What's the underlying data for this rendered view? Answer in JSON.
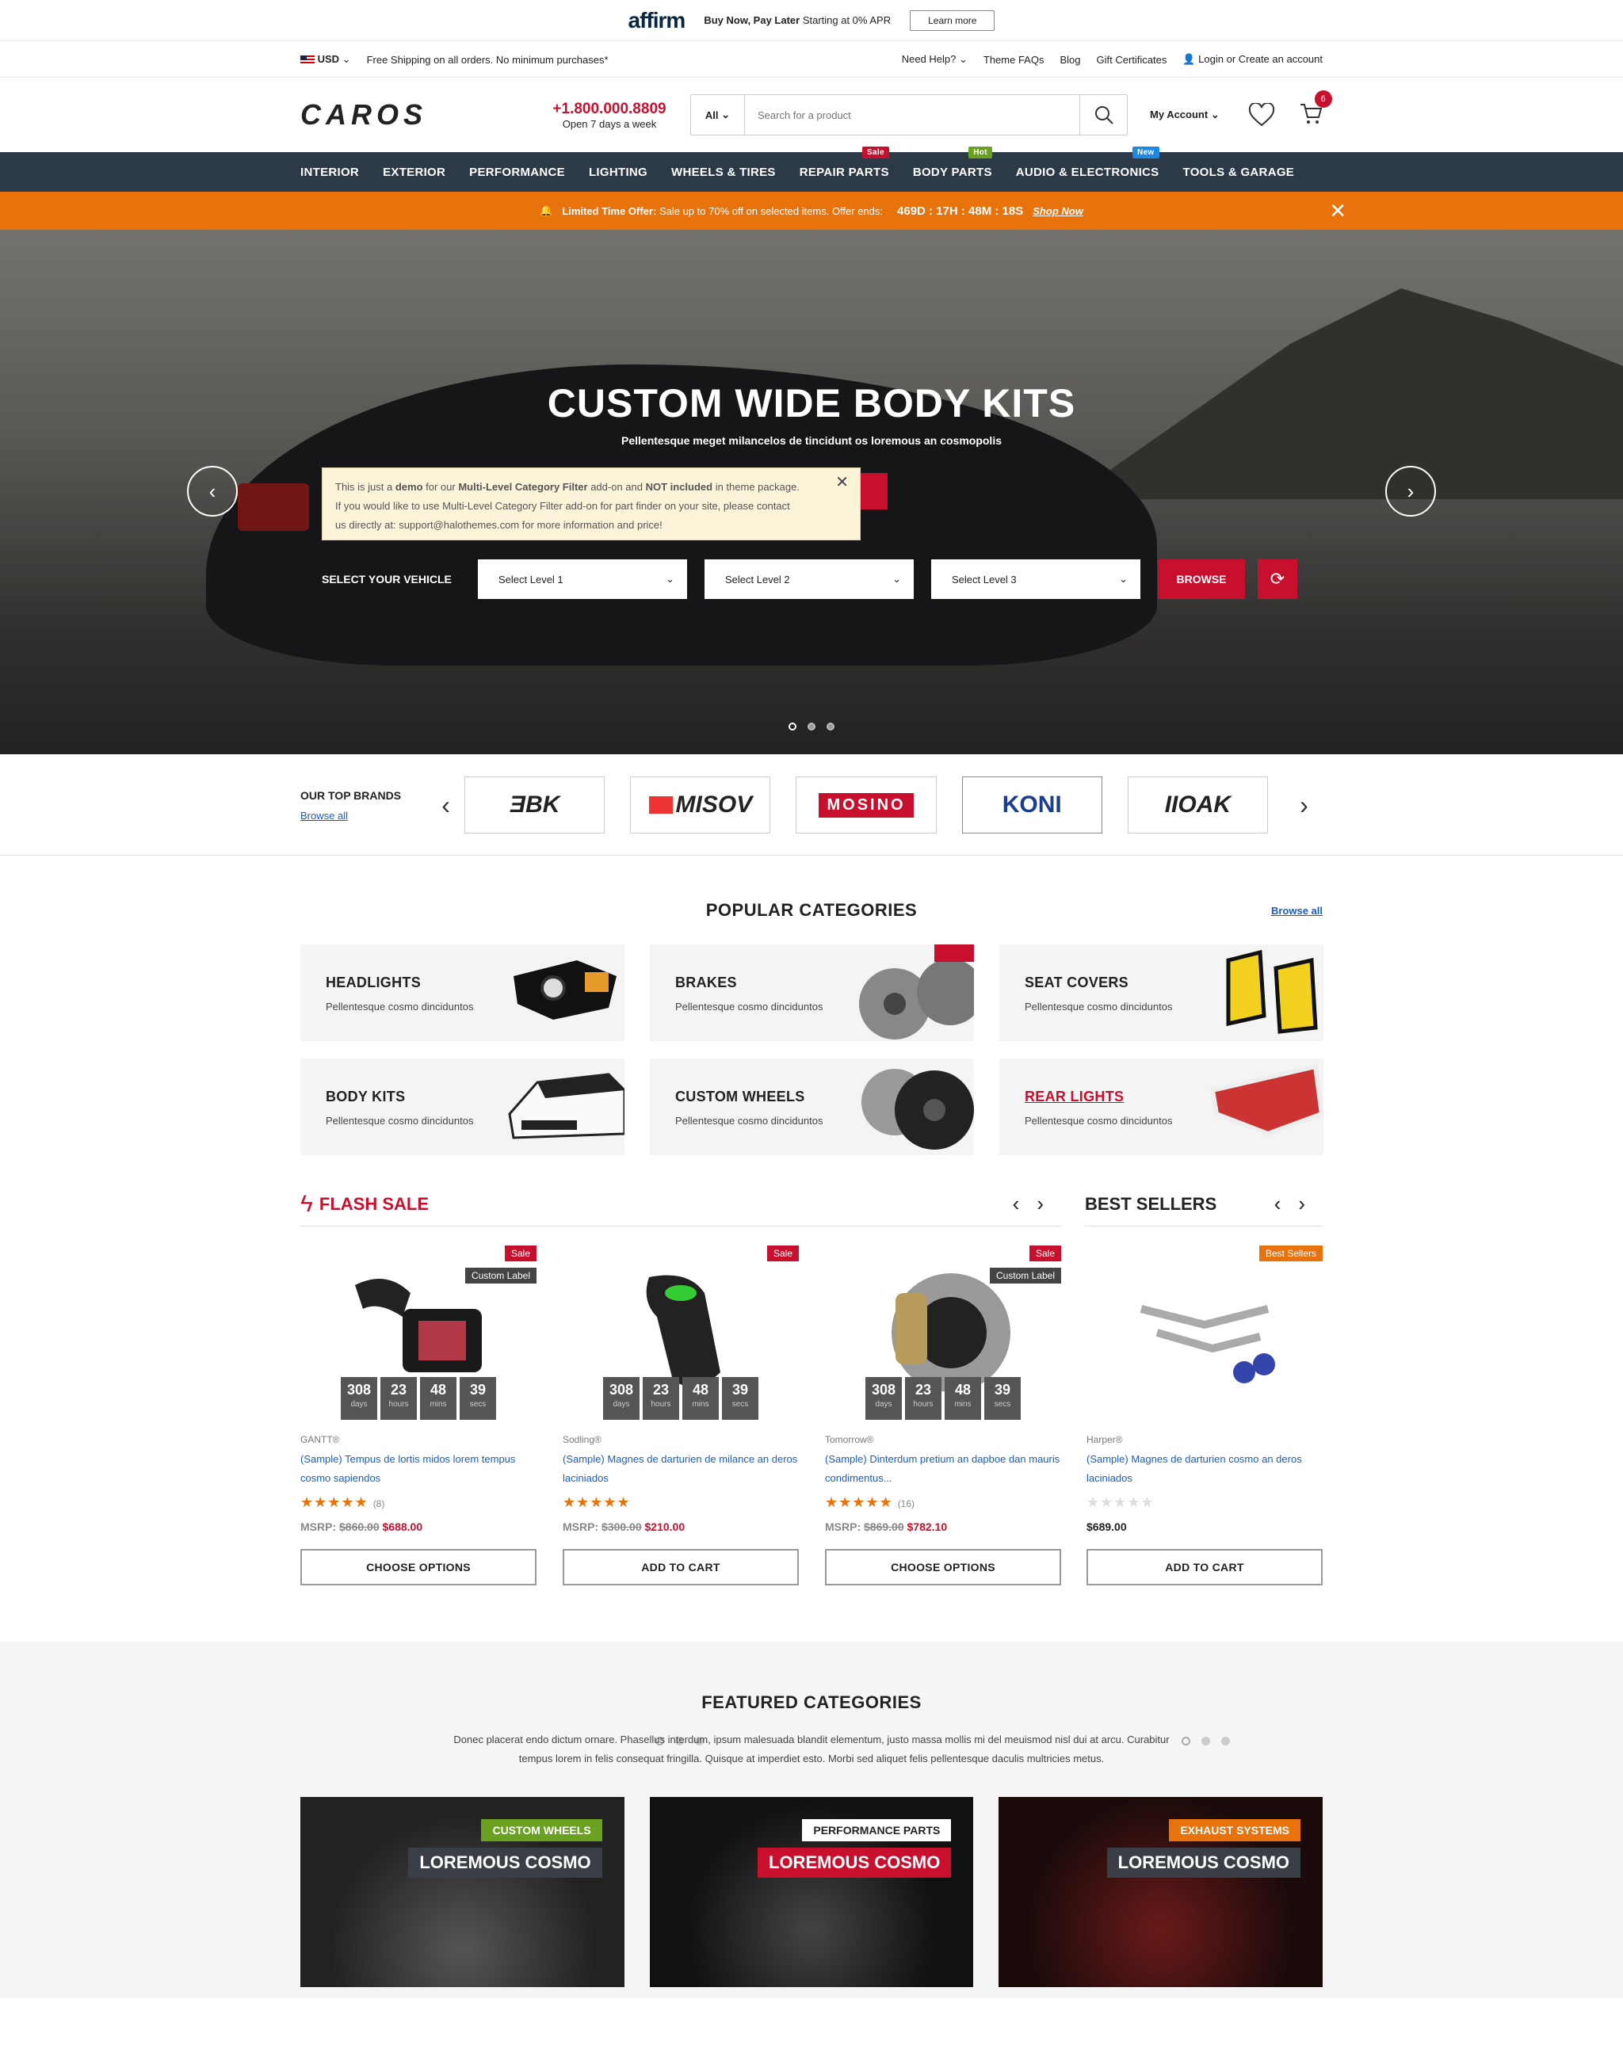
{
  "affirm": {
    "logo": "affirm",
    "text_bold": "Buy Now, Pay Later",
    "text": " Starting at 0% APR",
    "button": "Learn more"
  },
  "topbar": {
    "currency": "USD",
    "shipping": "Free Shipping on all orders. No minimum purchases*",
    "links": [
      "Need Help?",
      "Theme FAQs",
      "Blog",
      "Gift Certificates"
    ],
    "login": "Login or Create an account"
  },
  "header": {
    "logo": "CAROS",
    "phone": "+1.800.000.8809",
    "phone_sub": "Open 7 days a week",
    "search_cat": "All",
    "search_placeholder": "Search for a product",
    "account": "My Account",
    "cart_count": "6"
  },
  "nav": {
    "items": [
      "INTERIOR",
      "EXTERIOR",
      "PERFORMANCE",
      "LIGHTING",
      "WHEELS & TIRES",
      "REPAIR PARTS",
      "BODY PARTS",
      "AUDIO & ELECTRONICS",
      "TOOLS & GARAGE"
    ],
    "tags": {
      "sale": "Sale",
      "hot": "Hot",
      "new": "New"
    },
    "tag_colors": {
      "sale": "#c8102e",
      "hot": "#6aa121",
      "new": "#1e88e5"
    }
  },
  "promo": {
    "label": "Limited Time Offer:",
    "text": "Sale up to 70% off on selected items. Offer ends:",
    "countdown": "469D : 17H : 48M : 18S",
    "link": "Shop Now"
  },
  "hero": {
    "title": "CUSTOM WIDE BODY KITS",
    "subtitle": "Pellentesque meget milancelos de tincidunt os loremous an cosmopolis",
    "notice_1": "This is just a ",
    "notice_demo": "demo",
    "notice_2": " for our ",
    "notice_addon": "Multi-Level Category Filter",
    "notice_3": " add-on and ",
    "notice_not": "NOT included",
    "notice_4": " in theme package.",
    "notice_line2": "If you would like to use Multi-Level Category Filter add-on for part finder on your site, please contact",
    "notice_line3": "us directly at: support@halothemes.com for more information and price!",
    "finder_label": "SELECT YOUR VEHICLE",
    "levels": [
      "Select Level 1",
      "Select Level 2",
      "Select Level 3"
    ],
    "browse": "BROWSE"
  },
  "brands": {
    "title": "OUR TOP BRANDS",
    "browse": "Browse all",
    "logos": [
      "ƎBK",
      "MISOV",
      "MOSINO",
      "KONI",
      "IIOAK"
    ]
  },
  "popular": {
    "title": "POPULAR CATEGORIES",
    "browse": "Browse all",
    "items": [
      {
        "title": "HEADLIGHTS",
        "sub": "Pellentesque cosmo dinciduntos"
      },
      {
        "title": "BRAKES",
        "sub": "Pellentesque cosmo dinciduntos"
      },
      {
        "title": "SEAT COVERS",
        "sub": "Pellentesque cosmo dinciduntos"
      },
      {
        "title": "BODY KITS",
        "sub": "Pellentesque cosmo dinciduntos"
      },
      {
        "title": "CUSTOM WHEELS",
        "sub": "Pellentesque cosmo dinciduntos"
      },
      {
        "title": "REAR LIGHTS",
        "sub": "Pellentesque cosmo dinciduntos"
      }
    ]
  },
  "flash": {
    "title": "FLASH SALE",
    "bestsellers": "BEST SELLERS",
    "timer": {
      "days": "308",
      "hours": "23",
      "mins": "48",
      "secs": "39",
      "l_days": "days",
      "l_hours": "hours",
      "l_mins": "mins",
      "l_secs": "secs"
    },
    "products": [
      {
        "brand": "GANTT®",
        "name": "(Sample) Tempus de lortis midos lorem tempus cosmo sapiendos",
        "reviews": "(8)",
        "msrp": "MSRP:",
        "old": "$860.00",
        "price": "$688.00",
        "button": "CHOOSE OPTIONS",
        "label1": "Sale",
        "label2": "Custom Label"
      },
      {
        "brand": "Sodling®",
        "name": "(Sample) Magnes de darturien de milance an deros laciniados",
        "reviews": "",
        "msrp": "MSRP:",
        "old": "$300.00",
        "price": "$210.00",
        "button": "ADD TO CART",
        "label1": "Sale",
        "label2": ""
      },
      {
        "brand": "Tomorrow®",
        "name": "(Sample) Dinterdum pretium an dapboe dan mauris condimentus...",
        "reviews": "(16)",
        "msrp": "MSRP:",
        "old": "$869.00",
        "price": "$782.10",
        "button": "CHOOSE OPTIONS",
        "label1": "Sale",
        "label2": "Custom Label"
      },
      {
        "brand": "Harper®",
        "name": "(Sample) Magnes de darturien cosmo an deros laciniados",
        "reviews": "",
        "msrp": "",
        "old": "",
        "price": "$689.00",
        "button": "ADD TO CART",
        "label1": "Best Sellers",
        "label2": ""
      }
    ]
  },
  "featured": {
    "title": "FEATURED CATEGORIES",
    "desc": "Donec placerat endo dictum ornare. Phasellus interdum, ipsum malesuada blandit elementum, justo massa mollis mi del meuismod nisl dui at arcu. Curabitur tempus lorem in felis consequat fringilla. Quisque at imperdiet esto. Morbi sed aliquet felis pellentesque daculis multricies metus.",
    "cards": [
      {
        "tag": "CUSTOM WHEELS",
        "title": "LOREMOUS COSMO"
      },
      {
        "tag": "PERFORMANCE PARTS",
        "title": "LOREMOUS COSMO"
      },
      {
        "tag": "EXHAUST SYSTEMS",
        "title": "LOREMOUS COSMO"
      }
    ]
  }
}
